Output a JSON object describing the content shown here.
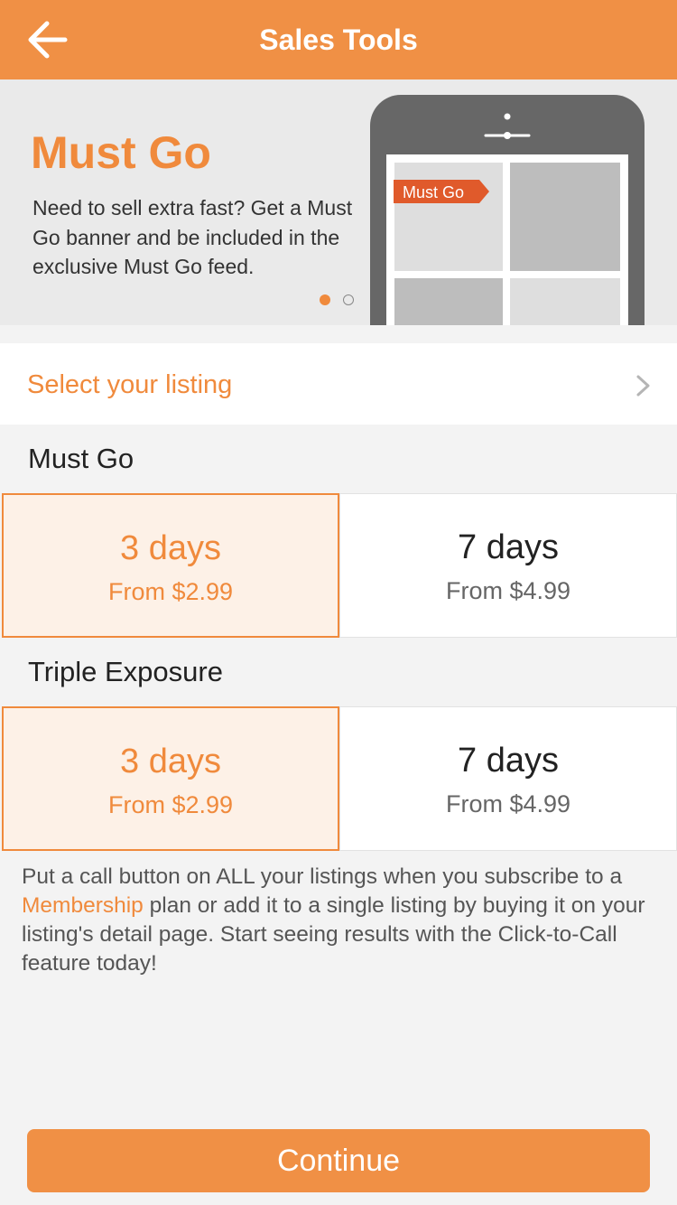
{
  "header": {
    "title": "Sales Tools",
    "back_icon": "arrow-left-icon"
  },
  "hero": {
    "title": "Must Go",
    "description": "Need to sell extra fast? Get a Must Go banner and be included in the exclusive Must Go feed.",
    "banner_label": "Must Go",
    "carousel": {
      "total": 2,
      "active": 1
    }
  },
  "listing": {
    "label": "Select your listing",
    "icon": "chevron-right-icon"
  },
  "sections": [
    {
      "title": "Must Go",
      "options": [
        {
          "days": "3 days",
          "price": "From $2.99",
          "selected": true
        },
        {
          "days": "7 days",
          "price": "From $4.99",
          "selected": false
        }
      ]
    },
    {
      "title": "Triple Exposure",
      "options": [
        {
          "days": "3 days",
          "price": "From $2.99",
          "selected": true
        },
        {
          "days": "7 days",
          "price": "From $4.99",
          "selected": false
        }
      ]
    }
  ],
  "info": {
    "before": "Put a call button on ALL your listings when you subscribe to a ",
    "link": "Membership",
    "after": " plan or add it to a single listing by buying it on your listing's detail page. Start seeing results with the Click-to-Call feature today!"
  },
  "continue_label": "Continue",
  "colors": {
    "accent": "#f09045",
    "accent_text": "#f08a3c",
    "selected_bg": "#fdf1e7",
    "banner_red": "#e05a2b"
  }
}
